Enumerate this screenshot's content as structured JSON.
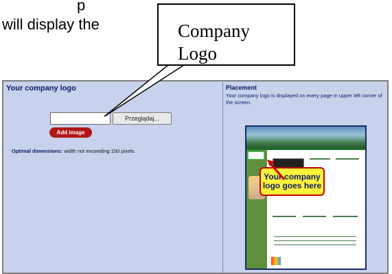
{
  "document": {
    "line1": "p",
    "line2": "will display the"
  },
  "callout": {
    "line1": "Company",
    "line2": "Logo"
  },
  "left_pane": {
    "title": "Your company logo",
    "browse_button": "Przeglądaj...",
    "add_button": "Add image",
    "dimensions_label": "Optimal dimensions:",
    "dimensions_text": "width not exceeding 150 pixels."
  },
  "right_pane": {
    "title": "Placement",
    "description": "Your company logo is displayed on every page in upper left corner of the screen.",
    "sticker": "Your company logo goes here"
  },
  "colors": {
    "panel_bg": "#c8d2ec",
    "title_blue": "#0a1a66",
    "add_button_red": "#b01818",
    "sticker_yellow": "#fff23a",
    "sticker_border": "#c80000"
  }
}
